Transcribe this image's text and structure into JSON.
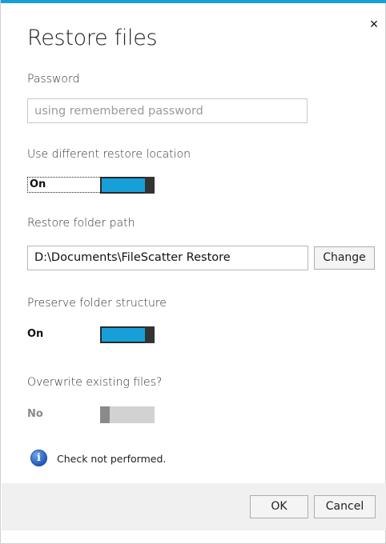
{
  "dialog": {
    "title": "Restore files",
    "close_glyph": "×"
  },
  "password": {
    "label": "Password",
    "placeholder": "using remembered password",
    "value": ""
  },
  "restore_location": {
    "label": "Use different restore location",
    "state": "On",
    "enabled": true
  },
  "restore_path": {
    "label": "Restore folder path",
    "value": "D:\\Documents\\FileScatter Restore",
    "change_label": "Change"
  },
  "preserve_structure": {
    "label": "Preserve folder structure",
    "state": "On",
    "enabled": true
  },
  "overwrite": {
    "label": "Overwrite existing files?",
    "state": "No",
    "enabled": false
  },
  "info": {
    "icon": "info-icon",
    "text": "Check not performed."
  },
  "footer": {
    "ok_label": "OK",
    "cancel_label": "Cancel"
  },
  "colors": {
    "accent": "#17a0d8",
    "toggle_off": "#d2d2d2",
    "footer_bg": "#f0f0f0"
  }
}
